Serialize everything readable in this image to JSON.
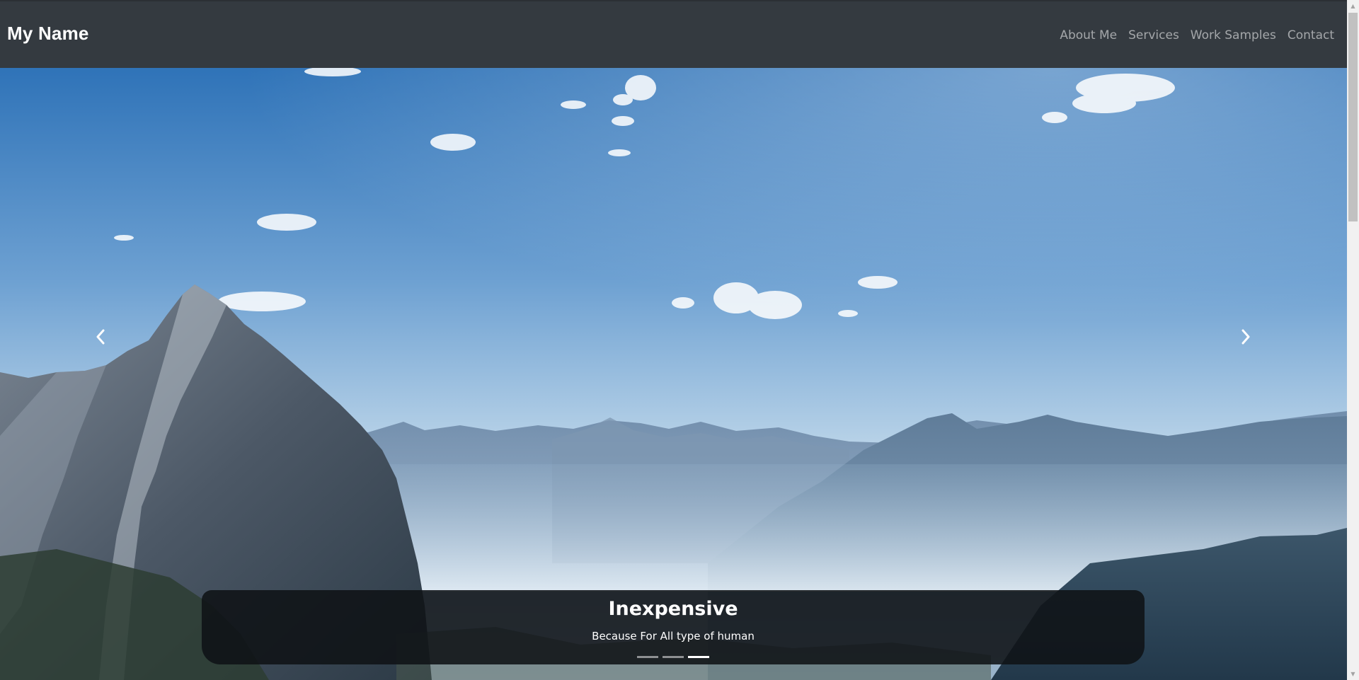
{
  "navbar": {
    "brand": "My Name",
    "links": [
      "About Me",
      "Services",
      "Work Samples",
      "Contact"
    ],
    "background": "#343a40"
  },
  "carousel": {
    "caption": {
      "title": "Inexpensive",
      "text": "Because For All type of human"
    },
    "indicators": {
      "count": 3,
      "active_index": 2
    },
    "prev_icon": "chevron-left-icon",
    "next_icon": "chevron-right-icon",
    "image_subject": "mountain-landscape"
  },
  "scrollbar": {
    "up_icon": "triangle-up-icon",
    "down_icon": "triangle-down-icon"
  }
}
